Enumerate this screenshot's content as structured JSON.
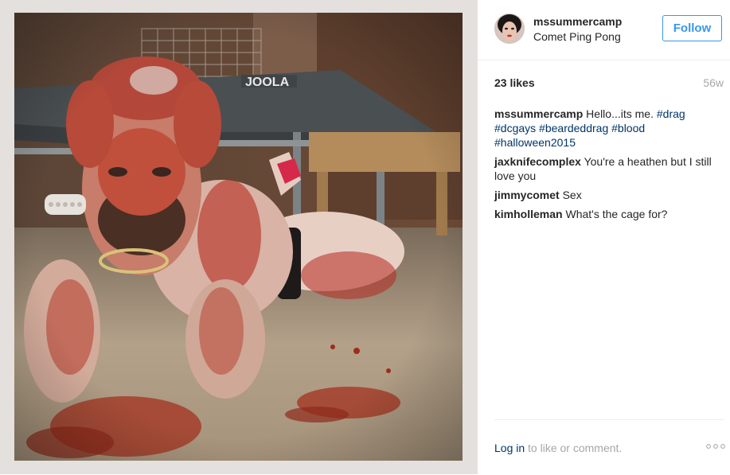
{
  "post": {
    "photo_alt": "",
    "author": {
      "username": "mssummercamp",
      "location": "Comet Ping Pong",
      "avatar_icon": "avatar-icon"
    },
    "follow_label": "Follow",
    "likes": "23 likes",
    "age": "56w",
    "caption": {
      "author": "mssummercamp",
      "text": "Hello...its me.",
      "tags": [
        "#drag",
        "#dcgays",
        "#beardeddrag",
        "#blood",
        "#halloween2015"
      ]
    },
    "comments": [
      {
        "author": "jaxknifecomplex",
        "text": "You're a heathen but I still love you"
      },
      {
        "author": "jimmycomet",
        "text": "Sex"
      },
      {
        "author": "kimholleman",
        "text": "What's the cage for?"
      }
    ],
    "footer": {
      "login_link": "Log in",
      "login_suffix": "to like or comment.",
      "more_icon": "more-options-icon"
    }
  },
  "colors": {
    "link": "#003569",
    "follow": "#3897f0",
    "muted": "#a5a7aa",
    "text": "#262626"
  }
}
